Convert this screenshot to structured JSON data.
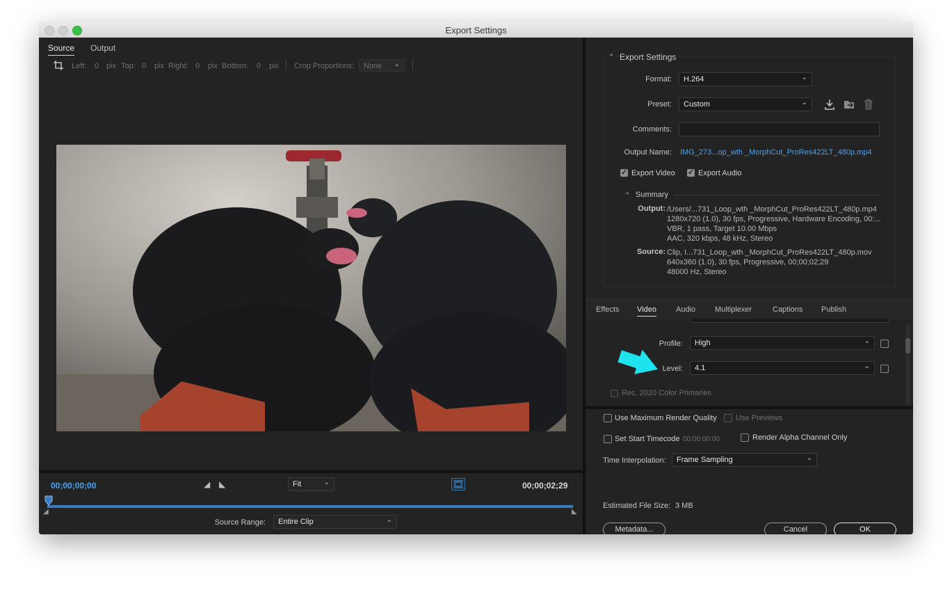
{
  "window": {
    "title": "Export Settings"
  },
  "left": {
    "tabs": [
      {
        "label": "Source"
      },
      {
        "label": "Output"
      }
    ],
    "crop": {
      "left_label": "Left:",
      "left_val": "0",
      "pix1": "pix",
      "top_label": "Top:",
      "top_val": "0",
      "pix2": "pix",
      "right_label": "Right:",
      "right_val": "0",
      "pix3": "pix",
      "bottom_label": "Bottom:",
      "bottom_val": "0",
      "pix4": "pix",
      "prop_label": "Crop Proportions:",
      "prop_value": "None"
    },
    "timeline": {
      "current": "00;00;00;00",
      "duration": "00;00;02;29",
      "zoom": "Fit",
      "source_range_label": "Source Range:",
      "source_range_value": "Entire Clip"
    }
  },
  "export_settings": {
    "section_title": "Export Settings",
    "format_label": "Format:",
    "format_value": "H.264",
    "preset_label": "Preset:",
    "preset_value": "Custom",
    "comments_label": "Comments:",
    "comments_value": "",
    "output_name_label": "Output Name:",
    "output_name_value": "IMG_273...op_wth _MorphCut_ProRes422LT_480p.mp4",
    "export_video_label": "Export Video",
    "export_video_checked": true,
    "export_audio_label": "Export Audio",
    "export_audio_checked": true,
    "summary": {
      "title": "Summary",
      "output_label": "Output:",
      "output_lines": [
        "/Users/...731_Loop_wth _MorphCut_ProRes422LT_480p.mp4",
        "1280x720 (1.0), 30 fps, Progressive, Hardware Encoding, 00:...",
        "VBR, 1 pass, Target 10.00 Mbps",
        "AAC, 320 kbps, 48 kHz, Stereo"
      ],
      "source_label": "Source:",
      "source_lines": [
        "Clip, I...731_Loop_wth _MorphCut_ProRes422LT_480p.mov",
        "640x360 (1.0), 30 fps, Progressive, 00;00;02;29",
        "48000 Hz, Stereo"
      ]
    }
  },
  "settings_tabs": [
    {
      "label": "Effects"
    },
    {
      "label": "Video"
    },
    {
      "label": "Audio"
    },
    {
      "label": "Multiplexer"
    },
    {
      "label": "Captions"
    },
    {
      "label": "Publish"
    }
  ],
  "video": {
    "profile_label": "Profile:",
    "profile_value": "High",
    "level_label": "Level:",
    "level_value": "4.1",
    "rec2020_label": "Rec. 2020 Color Primaries",
    "annotation_arrow_color": "#1ee3ee"
  },
  "bottom": {
    "max_render_label": "Use Maximum Render Quality",
    "use_previews_label": "Use Previews",
    "start_tc_label": "Set Start Timecode",
    "start_tc_value": "00:00:00:00",
    "alpha_label": "Render Alpha Channel Only",
    "interp_label": "Time Interpolation:",
    "interp_value": "Frame Sampling",
    "file_size_label": "Estimated File Size:",
    "file_size_value": "3 MB",
    "metadata_btn": "Metadata...",
    "cancel_btn": "Cancel",
    "ok_btn": "OK"
  },
  "colors": {
    "accent_blue": "#4aa3f2",
    "panel_bg": "#232323",
    "divider": "#101010"
  }
}
